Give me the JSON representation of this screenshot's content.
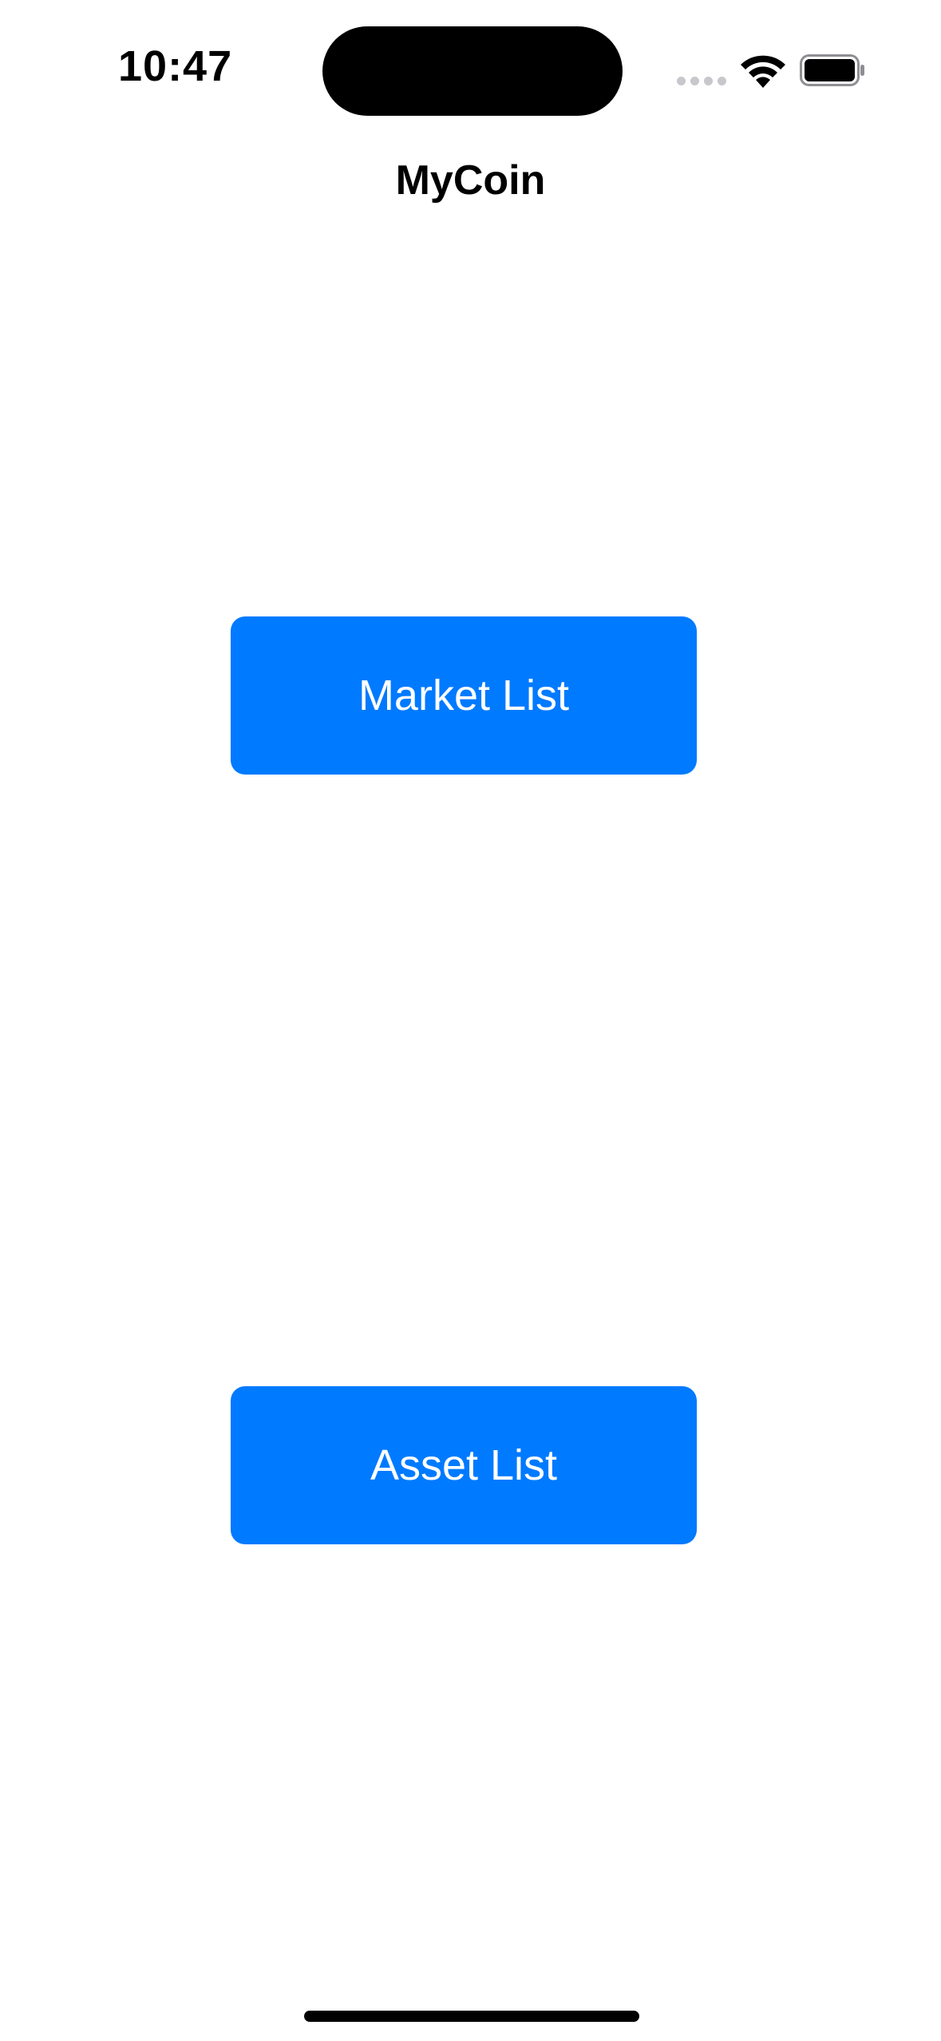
{
  "status_bar": {
    "time": "10:47",
    "wifi_icon": "wifi-icon",
    "signal_icon": "cellular-signal-icon",
    "battery_icon": "battery-icon"
  },
  "navigation": {
    "title": "MyCoin"
  },
  "main": {
    "market_button_label": "Market List",
    "asset_button_label": "Asset List"
  },
  "colors": {
    "accent": "#007aff",
    "background": "#ffffff",
    "text": "#000000"
  }
}
